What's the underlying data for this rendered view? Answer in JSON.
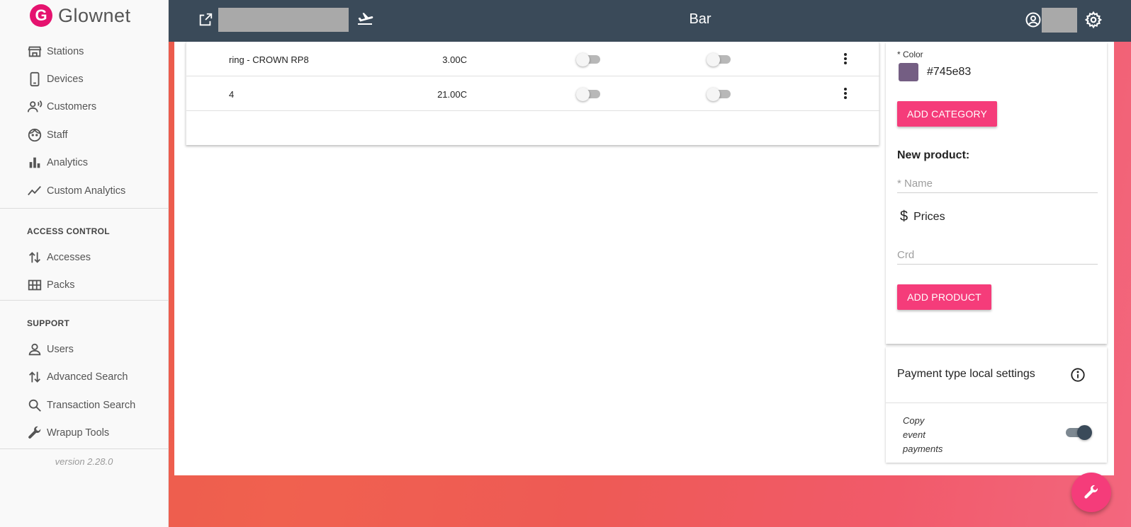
{
  "app": {
    "logo_text": "Glownet",
    "version": "version 2.28.0"
  },
  "sidebar": {
    "items": [
      {
        "label": "Stations",
        "icon": "store-icon"
      },
      {
        "label": "Devices",
        "icon": "phone-icon"
      },
      {
        "label": "Customers",
        "icon": "customers-icon"
      },
      {
        "label": "Staff",
        "icon": "face-icon"
      },
      {
        "label": "Analytics",
        "icon": "bar-chart-icon"
      },
      {
        "label": "Custom Analytics",
        "icon": "trend-line-icon"
      }
    ],
    "access_control": {
      "title": "ACCESS CONTROL",
      "items": [
        {
          "label": "Accesses",
          "icon": "swap-vertical-icon"
        },
        {
          "label": "Packs",
          "icon": "grid-icon"
        }
      ]
    },
    "support": {
      "title": "SUPPORT",
      "items": [
        {
          "label": "Users",
          "icon": "user-icon"
        },
        {
          "label": "Advanced Search",
          "icon": "swap-vertical-icon"
        },
        {
          "label": "Transaction Search",
          "icon": "search-icon"
        },
        {
          "label": "Wrapup Tools",
          "icon": "wrench-icon"
        }
      ]
    }
  },
  "header": {
    "title": "Bar"
  },
  "products": {
    "rows": [
      {
        "name": "ring - CROWN RP8",
        "price": "3.00C",
        "toggle_a": false,
        "toggle_b": false
      },
      {
        "name": "4",
        "price": "21.00C",
        "toggle_a": false,
        "toggle_b": false
      }
    ]
  },
  "category_form": {
    "color_label": "* Color",
    "color_value": "#745e83",
    "add_button": "ADD CATEGORY"
  },
  "product_form": {
    "title": "New product:",
    "name_placeholder": "* Name",
    "prices_label": "Prices",
    "crd_placeholder": "Crd",
    "add_button": "ADD PRODUCT"
  },
  "payment_settings": {
    "title": "Payment type local settings",
    "copy_label": "Copy event payments",
    "copy_enabled": true
  },
  "colors": {
    "header": "#3a4a59",
    "accent": "#f53c7a",
    "logo": "#e5136f"
  }
}
